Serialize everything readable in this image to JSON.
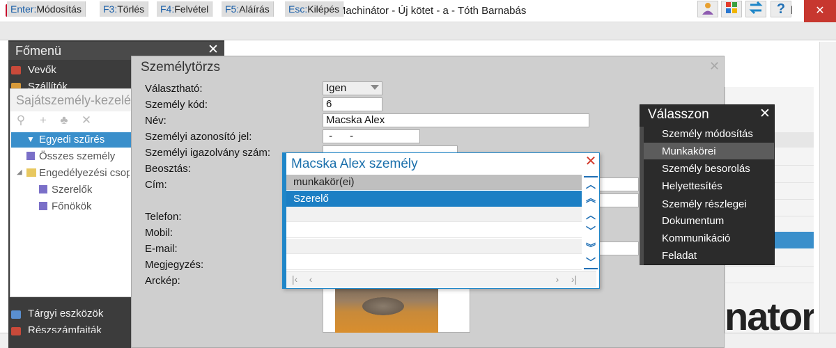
{
  "window": {
    "title": "Nagy Machinátor - Új kötet - a - Tóth Barnabás",
    "minimize_glyph": "—",
    "maximize_glyph": "☐",
    "close_glyph": "✕"
  },
  "toolbar": {
    "keys": [
      {
        "key": "Enter:",
        "label": "Módosítás"
      },
      {
        "key": "F3:",
        "label": "Törlés"
      },
      {
        "key": "F4:",
        "label": "Felvétel"
      },
      {
        "key": "F5:",
        "label": "Aláírás"
      },
      {
        "key": "Esc:",
        "label": "Kilépés"
      }
    ],
    "icons": [
      "user-icon",
      "windows-icon",
      "swap-icon",
      "help-icon"
    ],
    "help_glyph": "?"
  },
  "mainmenu": {
    "title": "Főmenü",
    "items": [
      "Vevők",
      "Szállítók",
      "Tárgyi eszközök",
      "Részszámfajták"
    ]
  },
  "saj_panel": {
    "title": "Sajátszemély-kezelés",
    "tree": [
      "Egyedi szűrés",
      "Összes személy",
      "Engedélyezési csoportok",
      "Szerelők",
      "Főnökök"
    ]
  },
  "szemelytorzs": {
    "title": "Személytörzs",
    "labels": {
      "valaszthato": "Választható:",
      "kod": "Személy kód:",
      "nev": "Név:",
      "azonosito": "Személyi azonosító jel:",
      "igazolvany": "Személyi igazolvány szám:",
      "beosztas": "Beosztás:",
      "cim": "Cím:",
      "telefon": "Telefon:",
      "mobil": "Mobil:",
      "email": "E-mail:",
      "megjegyzes": "Megjegyzés:",
      "arckep": "Arckép:"
    },
    "values": {
      "valaszthato": "Igen",
      "kod": "6",
      "nev": "Macska Alex",
      "azonosito": " -      -"
    }
  },
  "popup": {
    "title": "Macska Alex személy",
    "column": "munkakör(ei)",
    "rows": [
      "Szerelő"
    ]
  },
  "valasszon": {
    "title": "Válasszon",
    "items": [
      "Személy módosítás",
      "Munkakörei",
      "Személy besorolás",
      "Helyettesítés",
      "Személy részlegei",
      "Dokumentum",
      "Kommunikáció",
      "Feladat"
    ],
    "selected_index": 1
  },
  "background_logo": "nator"
}
